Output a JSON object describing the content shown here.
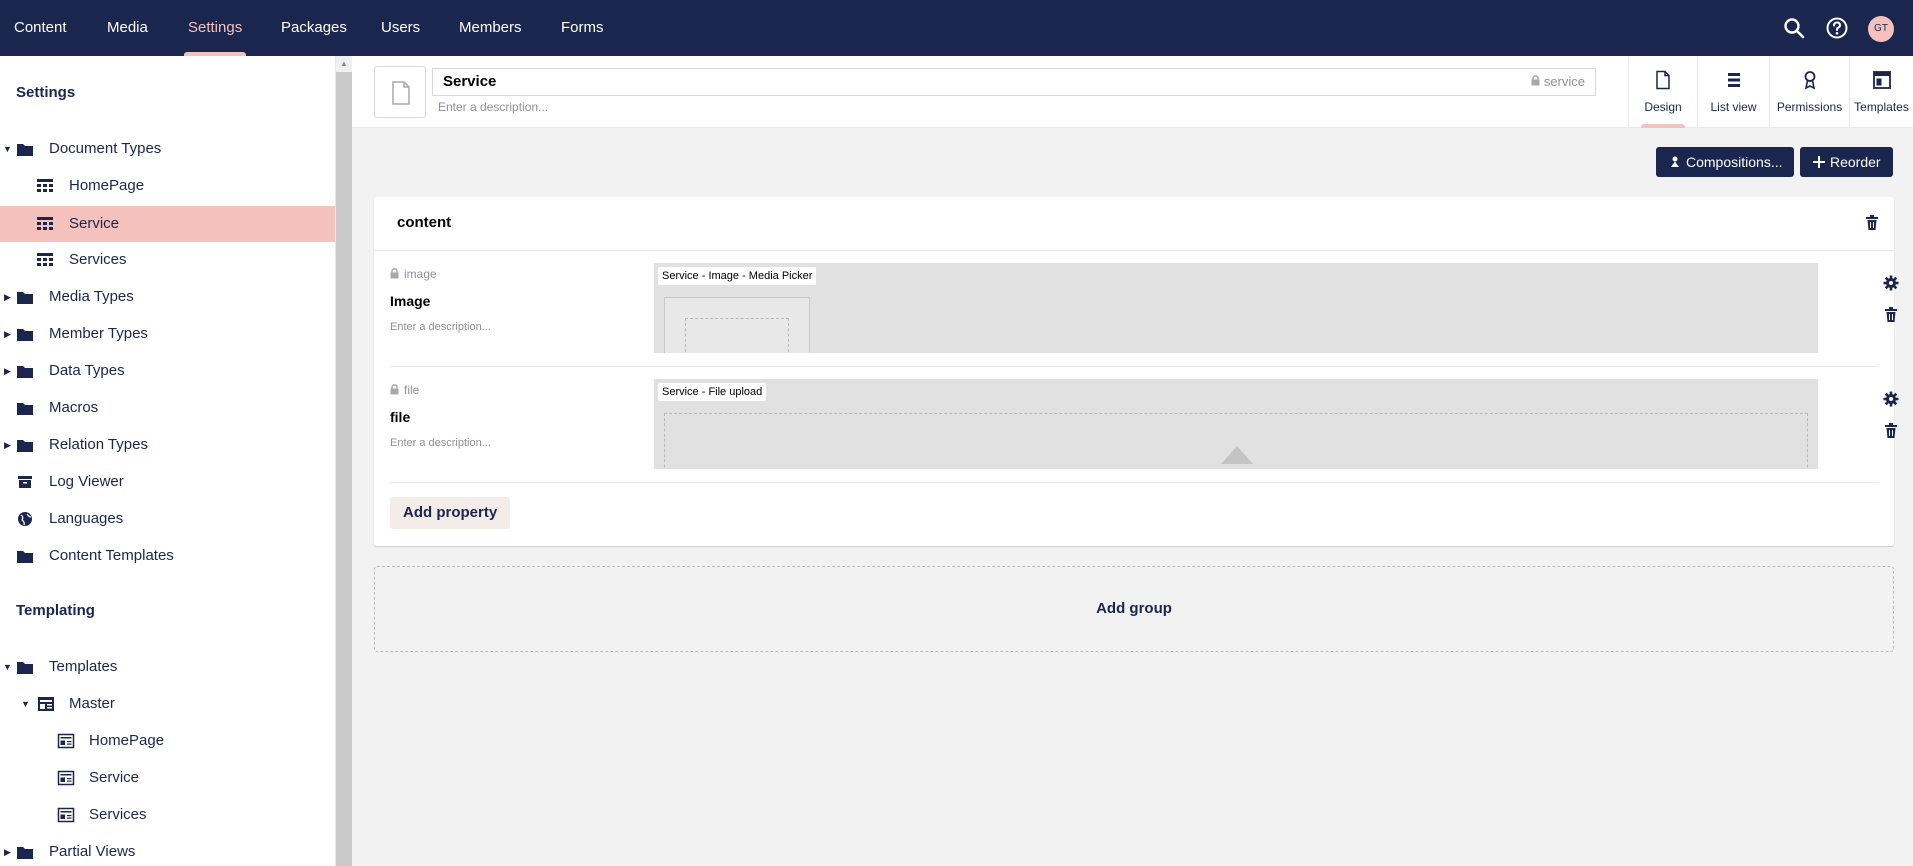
{
  "nav": {
    "items": [
      {
        "label": "Content"
      },
      {
        "label": "Media"
      },
      {
        "label": "Settings",
        "active": true
      },
      {
        "label": "Packages"
      },
      {
        "label": "Users"
      },
      {
        "label": "Members"
      },
      {
        "label": "Forms"
      }
    ],
    "avatar_initials": "GT"
  },
  "sidebar": {
    "settings_title": "Settings",
    "settings_items": [
      {
        "label": "Document Types",
        "caret": "down",
        "icon": "folder-icon"
      },
      {
        "label": "HomePage",
        "icon": "doc-type-icon"
      },
      {
        "label": "Service",
        "icon": "doc-type-icon",
        "selected": true
      },
      {
        "label": "Services",
        "icon": "doc-type-icon"
      },
      {
        "label": "Media Types",
        "caret": "right",
        "icon": "folder-icon"
      },
      {
        "label": "Member Types",
        "caret": "right",
        "icon": "folder-icon"
      },
      {
        "label": "Data Types",
        "caret": "right",
        "icon": "folder-icon"
      },
      {
        "label": "Macros",
        "icon": "folder-icon"
      },
      {
        "label": "Relation Types",
        "caret": "right",
        "icon": "folder-icon"
      },
      {
        "label": "Log Viewer",
        "icon": "box-icon"
      },
      {
        "label": "Languages",
        "icon": "globe-icon"
      },
      {
        "label": "Content Templates",
        "icon": "folder-icon"
      }
    ],
    "templating_title": "Templating",
    "templating_items": [
      {
        "label": "Templates",
        "caret": "down",
        "icon": "folder-icon"
      },
      {
        "label": "Master",
        "caret": "down",
        "icon": "template-icon"
      },
      {
        "label": "HomePage",
        "icon": "template-icon"
      },
      {
        "label": "Service",
        "icon": "template-icon"
      },
      {
        "label": "Services",
        "icon": "template-icon"
      },
      {
        "label": "Partial Views",
        "caret": "right",
        "icon": "folder-icon"
      }
    ]
  },
  "header": {
    "name": "Service",
    "alias": "service",
    "description_placeholder": "Enter a description...",
    "tabs": [
      {
        "label": "Design",
        "icon": "document-icon",
        "active": true
      },
      {
        "label": "List view",
        "icon": "list-icon"
      },
      {
        "label": "Permissions",
        "icon": "permissions-icon"
      },
      {
        "label": "Templates",
        "icon": "templates-icon"
      }
    ]
  },
  "toolbar": {
    "compositions_label": "Compositions...",
    "reorder_label": "Reorder"
  },
  "group": {
    "title": "content",
    "properties": [
      {
        "alias": "image",
        "name": "Image",
        "description": "Enter a description...",
        "editor": "Service - Image - Media Picker"
      },
      {
        "alias": "file",
        "name": "file",
        "description": "Enter a description...",
        "editor": "Service - File upload"
      }
    ],
    "add_property_label": "Add property"
  },
  "add_group_label": "Add group",
  "colors": {
    "nav_bg": "#1b264f",
    "accent": "#f5c1bc",
    "page_bg": "#f3f2f3"
  }
}
